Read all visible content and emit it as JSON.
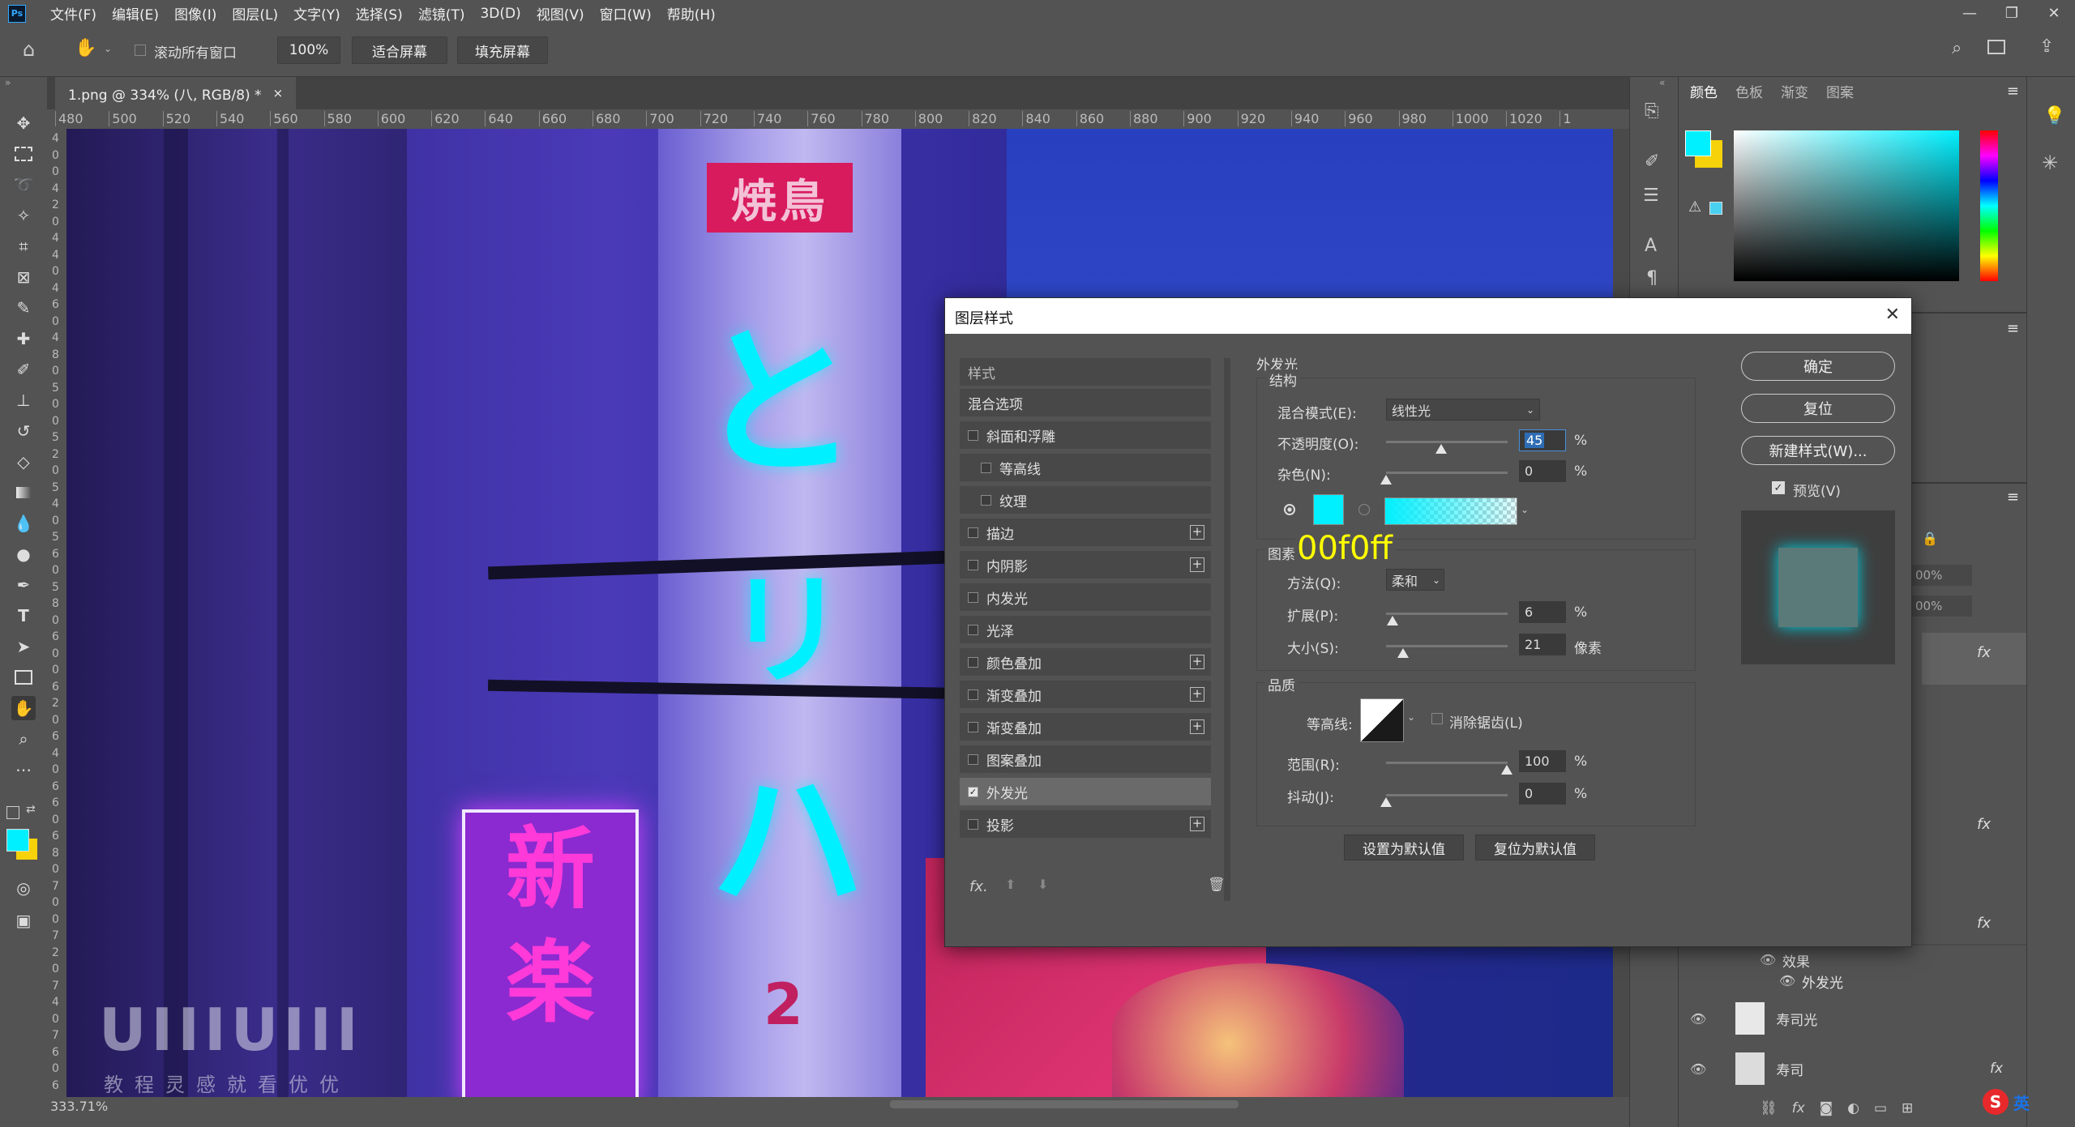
{
  "menubar": {
    "app_icon": "Ps",
    "items": [
      "文件(F)",
      "编辑(E)",
      "图像(I)",
      "图层(L)",
      "文字(Y)",
      "选择(S)",
      "滤镜(T)",
      "3D(D)",
      "视图(V)",
      "窗口(W)",
      "帮助(H)"
    ]
  },
  "options": {
    "scroll_all_label": "滚动所有窗口",
    "zoom_value": "100%",
    "fit_screen": "适合屏幕",
    "fill_screen": "填充屏幕"
  },
  "document": {
    "tab_title": "1.png @ 334% (八, RGB/8) *",
    "tab_close": "×",
    "zoom_status": "333.71%"
  },
  "ruler": {
    "h_ticks": [
      "480",
      "500",
      "520",
      "540",
      "560",
      "580",
      "600",
      "620",
      "640",
      "660",
      "680",
      "700",
      "720",
      "740",
      "760",
      "780",
      "800",
      "820",
      "840",
      "860",
      "880",
      "900",
      "920",
      "940",
      "960",
      "980",
      "1000",
      "1020",
      "1"
    ],
    "v_ticks": [
      "4",
      "0",
      "0",
      "4",
      "2",
      "0",
      "4",
      "4",
      "0",
      "4",
      "6",
      "0",
      "4",
      "8",
      "0",
      "5",
      "0",
      "0",
      "5",
      "2",
      "0",
      "5",
      "4",
      "0",
      "5",
      "6",
      "0",
      "5",
      "8",
      "0",
      "6",
      "0",
      "0",
      "6",
      "2",
      "0",
      "6",
      "4",
      "0",
      "6",
      "6",
      "0",
      "6",
      "8",
      "0",
      "7",
      "0",
      "0",
      "7",
      "2",
      "0",
      "7",
      "4",
      "0",
      "7",
      "6",
      "0",
      "6"
    ]
  },
  "canvas_text": {
    "sign_top": "焼鳥",
    "glyph_1": "と",
    "glyph_2": "リ",
    "glyph_3": "ハ",
    "neon_1": "新",
    "neon_2": "楽",
    "number": "2",
    "watermark_top": "UIIIUIII",
    "watermark_bottom": "教程灵感就看优优"
  },
  "right_panel": {
    "tabs": [
      "颜色",
      "色板",
      "渐变",
      "图案"
    ],
    "opacity_1": "00%",
    "opacity_2": "00%",
    "effects_label": "效果",
    "effect_outer_glow": "外发光",
    "layer_1": "寿司光",
    "layer_2": "寿司",
    "fx": "fx"
  },
  "colors": {
    "foreground": "#00f0ff",
    "background": "#f5d20a",
    "annotation": "#ffff00"
  },
  "dialog": {
    "title": "图层样式",
    "close": "✕",
    "styles_header": "样式",
    "blend_options": "混合选项",
    "effects": [
      {
        "label": "斜面和浮雕",
        "checked": false,
        "plus": false,
        "indent": false
      },
      {
        "label": "等高线",
        "checked": false,
        "plus": false,
        "indent": true
      },
      {
        "label": "纹理",
        "checked": false,
        "plus": false,
        "indent": true
      },
      {
        "label": "描边",
        "checked": false,
        "plus": true,
        "indent": false
      },
      {
        "label": "内阴影",
        "checked": false,
        "plus": true,
        "indent": false
      },
      {
        "label": "内发光",
        "checked": false,
        "plus": false,
        "indent": false
      },
      {
        "label": "光泽",
        "checked": false,
        "plus": false,
        "indent": false
      },
      {
        "label": "颜色叠加",
        "checked": false,
        "plus": true,
        "indent": false
      },
      {
        "label": "渐变叠加",
        "checked": false,
        "plus": true,
        "indent": false
      },
      {
        "label": "渐变叠加",
        "checked": false,
        "plus": true,
        "indent": false
      },
      {
        "label": "图案叠加",
        "checked": false,
        "plus": false,
        "indent": false
      },
      {
        "label": "外发光",
        "checked": true,
        "plus": false,
        "indent": false
      },
      {
        "label": "投影",
        "checked": false,
        "plus": true,
        "indent": false
      }
    ],
    "panel_title": "外发光",
    "structure": "结构",
    "blend_mode_label": "混合模式(E):",
    "blend_mode_value": "线性光",
    "opacity_label": "不透明度(O):",
    "opacity_value": "45",
    "noise_label": "杂色(N):",
    "noise_value": "0",
    "percent": "%",
    "elements": "图素",
    "annotation_hex": "00f0ff",
    "technique_label": "方法(Q):",
    "technique_value": "柔和",
    "spread_label": "扩展(P):",
    "spread_value": "6",
    "size_label": "大小(S):",
    "size_value": "21",
    "pixels": "像素",
    "quality": "品质",
    "contour_label": "等高线:",
    "anti_alias_label": "消除锯齿(L)",
    "range_label": "范围(R):",
    "range_value": "100",
    "jitter_label": "抖动(J):",
    "jitter_value": "0",
    "set_default": "设置为默认值",
    "reset_default": "复位为默认值",
    "ok": "确定",
    "reset": "复位",
    "new_style": "新建样式(W)...",
    "preview": "预览(V)",
    "fx": "fx."
  },
  "taskbar": {
    "ime": "英"
  }
}
